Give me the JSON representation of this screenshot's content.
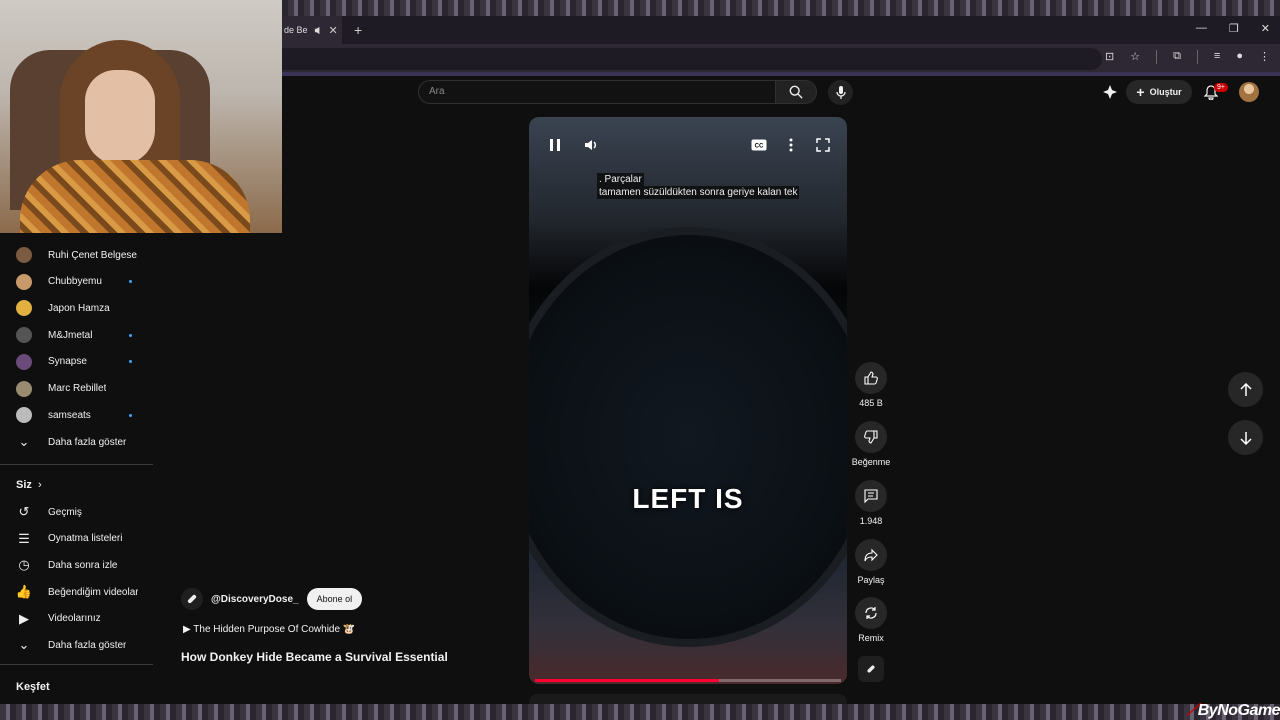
{
  "browser": {
    "tab_title": "de Be",
    "new_tab_symbol": "+",
    "close_symbol": "✕"
  },
  "header": {
    "search_placeholder": "Ara",
    "create_label": "Oluştur",
    "notification_count": "9+"
  },
  "sidebar": {
    "subscriptions": [
      {
        "label": "Ruhi Çenet Belgese...",
        "avatar_color": "#7a5a40",
        "new": false
      },
      {
        "label": "Chubbyemu",
        "avatar_color": "#c89a6a",
        "new": true
      },
      {
        "label": "Japon Hamza",
        "avatar_color": "#e0b040",
        "new": false
      },
      {
        "label": "M&Jmetal",
        "avatar_color": "#555555",
        "new": true
      },
      {
        "label": "Synapse",
        "avatar_color": "#6a4a7a",
        "new": true
      },
      {
        "label": "Marc Rebillet",
        "avatar_color": "#9a8a70",
        "new": false
      },
      {
        "label": "samseats",
        "avatar_color": "#bbbbbb",
        "new": true
      }
    ],
    "show_more_1": "Daha fazla göster",
    "you_heading": "Siz",
    "you_items": [
      {
        "label": "Geçmiş",
        "icon": "history-icon"
      },
      {
        "label": "Oynatma listeleri",
        "icon": "playlists-icon"
      },
      {
        "label": "Daha sonra izle",
        "icon": "watch-later-icon"
      },
      {
        "label": "Beğendiğim videolar",
        "icon": "liked-videos-icon"
      },
      {
        "label": "Videolarınız",
        "icon": "your-videos-icon"
      }
    ],
    "show_more_2": "Daha fazla göster",
    "explore_heading": "Keşfet"
  },
  "video": {
    "caption_line1": ". Parçalar",
    "caption_line2": "tamamen süzüldükten sonra geriye kalan tek",
    "big_caption": "LEFT IS",
    "progress": 0.6,
    "channel": "@DiscoveryDose_",
    "subscribe_label": "Abone ol",
    "playlist_line": "▶ The Hidden Purpose Of Cowhide 🐮",
    "title": "How Donkey Hide Became a Survival Essential"
  },
  "actions": {
    "like_count": "485 B",
    "dislike_label": "Beğenme",
    "comment_count": "1.948",
    "share_label": "Paylaş",
    "remix_label": "Remix"
  },
  "watermark": {
    "text": "ByNoGame"
  },
  "colors": {
    "accent_red": "#ff0033",
    "new_dot": "#3ea6ff",
    "background": "#0f0f0f"
  }
}
